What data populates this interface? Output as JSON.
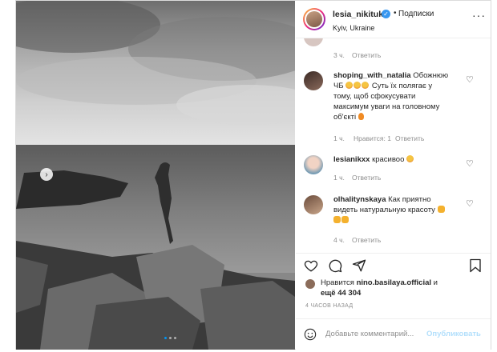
{
  "post": {
    "username": "lesia_nikituk",
    "follow_label": "Подписки",
    "bullet": "•",
    "location": "Kyiv, Ukraine",
    "more_icon": "more-horizontal-icon",
    "verified_icon": "verified-check-icon"
  },
  "comments": [
    {
      "username": "",
      "text": "",
      "time": "3 ч.",
      "likes": "",
      "reply": "Ответить"
    },
    {
      "username": "shoping_with_natalia",
      "text_lines": [
        "Обожнюю",
        "ЧБ",
        "Суть їх полягає у",
        "тому, щоб сфокусувати",
        "максимум уваги на головному",
        "об'єкті"
      ],
      "time": "1 ч.",
      "likes": "Нравится: 1",
      "reply": "Ответить"
    },
    {
      "username": "lesianikxx",
      "text": "красивоо",
      "time": "1 ч.",
      "likes": "",
      "reply": "Ответить"
    },
    {
      "username": "olhalitynskaya",
      "text_lines": [
        "Как приятно",
        "видеть натуральную красоту"
      ],
      "time": "4 ч.",
      "likes": "",
      "reply": "Ответить"
    }
  ],
  "likes": {
    "prefix": "Нравится",
    "user": "nino.basilaya.official",
    "conj": "и",
    "line2": "ещё 44 304"
  },
  "posted_time": "4 ЧАСОВ НАЗАД",
  "add_comment": {
    "placeholder": "Добавьте комментарий...",
    "publish": "Опубликовать"
  },
  "carousel": {
    "slide_count": 3,
    "active_index": 0
  }
}
